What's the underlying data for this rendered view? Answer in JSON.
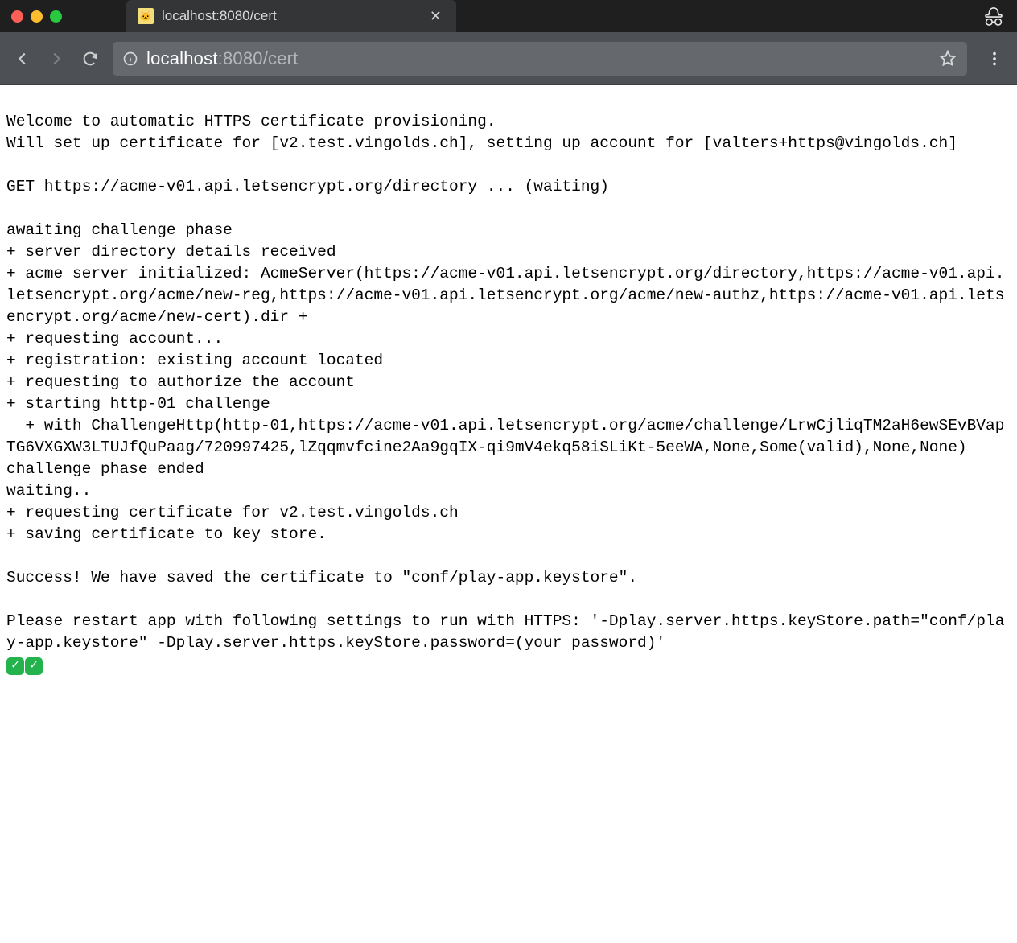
{
  "window": {
    "tab_title": "localhost:8080/cert"
  },
  "omnibox": {
    "host": "localhost",
    "rest": ":8080/cert"
  },
  "body": {
    "text": "Welcome to automatic HTTPS certificate provisioning.\nWill set up certificate for [v2.test.vingolds.ch], setting up account for [valters+https@vingolds.ch]\n\nGET https://acme-v01.api.letsencrypt.org/directory ... (waiting)\n\nawaiting challenge phase\n+ server directory details received\n+ acme server initialized: AcmeServer(https://acme-v01.api.letsencrypt.org/directory,https://acme-v01.api.letsencrypt.org/acme/new-reg,https://acme-v01.api.letsencrypt.org/acme/new-authz,https://acme-v01.api.letsencrypt.org/acme/new-cert).dir +\n+ requesting account...\n+ registration: existing account located\n+ requesting to authorize the account\n+ starting http-01 challenge\n  + with ChallengeHttp(http-01,https://acme-v01.api.letsencrypt.org/acme/challenge/LrwCjliqTM2aH6ewSEvBVapTG6VXGXW3LTUJfQuPaag/720997425,lZqqmvfcine2Aa9gqIX-qi9mV4ekq58iSLiKt-5eeWA,None,Some(valid),None,None)\nchallenge phase ended\nwaiting..\n+ requesting certificate for v2.test.vingolds.ch\n+ saving certificate to key store.\n\nSuccess! We have saved the certificate to \"conf/play-app.keystore\".\n\nPlease restart app with following settings to run with HTTPS: '-Dplay.server.https.keyStore.path=\"conf/play-app.keystore\" -Dplay.server.https.keyStore.password=(your password)'"
  }
}
